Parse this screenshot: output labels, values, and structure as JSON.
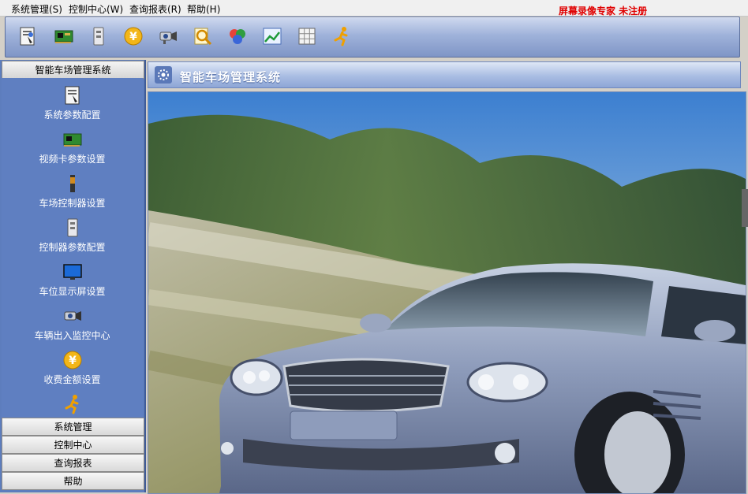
{
  "menubar": {
    "items": [
      {
        "label": "系统管理(S)"
      },
      {
        "label": "控制中心(W)"
      },
      {
        "label": "查询报表(R)"
      },
      {
        "label": "帮助(H)"
      }
    ],
    "watermark": "屏幕录像专家  未注册"
  },
  "toolbar": {
    "buttons": [
      {
        "icon": "settings-document-icon"
      },
      {
        "icon": "video-card-icon"
      },
      {
        "icon": "controller-icon"
      },
      {
        "icon": "yuan-coin-icon"
      },
      {
        "icon": "camera-icon"
      },
      {
        "icon": "magnifier-icon"
      },
      {
        "icon": "balls-icon"
      },
      {
        "icon": "chart-icon"
      },
      {
        "icon": "grid-icon"
      },
      {
        "icon": "running-man-icon"
      }
    ]
  },
  "sidebar": {
    "header": "智能车场管理系统",
    "tools": [
      {
        "label": "系统参数配置",
        "icon": "settings-document-icon"
      },
      {
        "label": "视频卡参数设置",
        "icon": "video-card-icon"
      },
      {
        "label": "车场控制器设置",
        "icon": "controller-icon"
      },
      {
        "label": "控制器参数配置",
        "icon": "cabinet-icon"
      },
      {
        "label": "车位显示屏设置",
        "icon": "monitor-icon"
      },
      {
        "label": "车辆出入监控中心",
        "icon": "camera-icon"
      },
      {
        "label": "收费金额设置",
        "icon": "yuan-coin-icon"
      },
      {
        "label": "",
        "icon": "running-man-icon"
      }
    ],
    "nav": [
      {
        "label": "系统管理"
      },
      {
        "label": "控制中心"
      },
      {
        "label": "查询报表"
      },
      {
        "label": "帮助"
      }
    ]
  },
  "content": {
    "title": "智能车场管理系统",
    "image": "silver-sports-car-photo"
  },
  "colors": {
    "toolbar_bg": "#9fb2da",
    "sidebar_bg": "#5f7fc1",
    "watermark": "#e00000"
  }
}
